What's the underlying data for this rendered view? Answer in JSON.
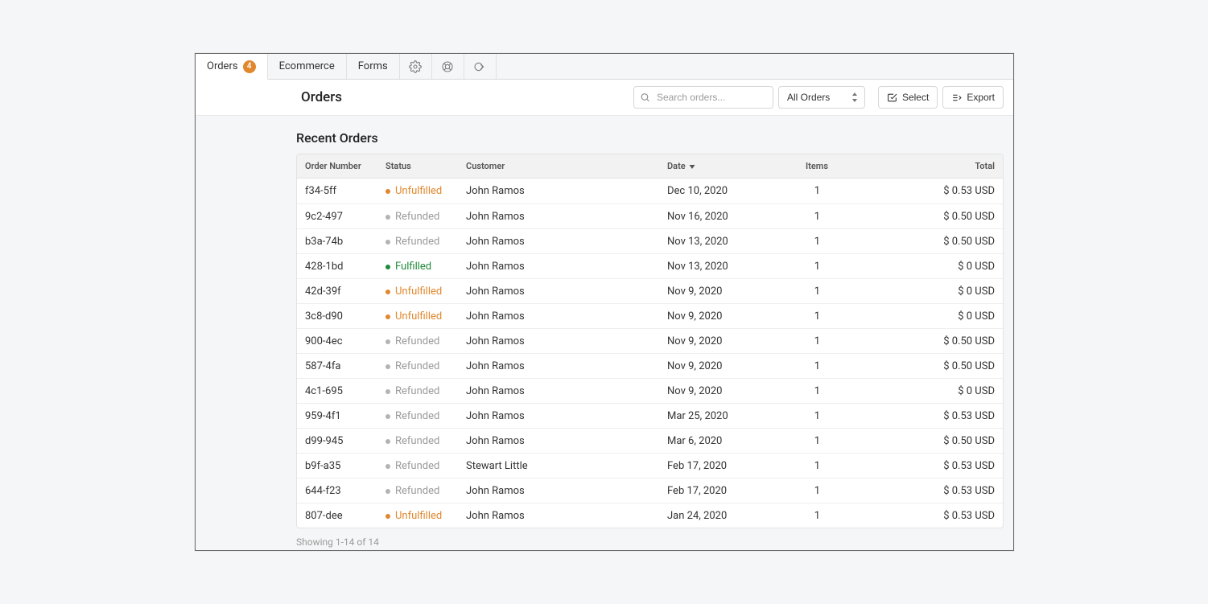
{
  "tabs": {
    "orders": {
      "label": "Orders",
      "badge": "4"
    },
    "ecommerce": {
      "label": "Ecommerce"
    },
    "forms": {
      "label": "Forms"
    }
  },
  "header": {
    "title": "Orders",
    "search_placeholder": "Search orders...",
    "filter_selected": "All Orders",
    "select_btn": "Select",
    "export_btn": "Export"
  },
  "section": {
    "title": "Recent Orders"
  },
  "columns": {
    "order_number": "Order Number",
    "status": "Status",
    "customer": "Customer",
    "date": "Date",
    "items": "Items",
    "total": "Total"
  },
  "statuses": {
    "unfulfilled": "Unfulfilled",
    "refunded": "Refunded",
    "fulfilled": "Fulfilled"
  },
  "rows": [
    {
      "order": "f34-5ff",
      "status": "unfulfilled",
      "customer": "John Ramos",
      "date": "Dec 10, 2020",
      "items": "1",
      "total": "$ 0.53 USD"
    },
    {
      "order": "9c2-497",
      "status": "refunded",
      "customer": "John Ramos",
      "date": "Nov 16, 2020",
      "items": "1",
      "total": "$ 0.50 USD"
    },
    {
      "order": "b3a-74b",
      "status": "refunded",
      "customer": "John Ramos",
      "date": "Nov 13, 2020",
      "items": "1",
      "total": "$ 0.50 USD"
    },
    {
      "order": "428-1bd",
      "status": "fulfilled",
      "customer": "John Ramos",
      "date": "Nov 13, 2020",
      "items": "1",
      "total": "$ 0 USD"
    },
    {
      "order": "42d-39f",
      "status": "unfulfilled",
      "customer": "John Ramos",
      "date": "Nov 9, 2020",
      "items": "1",
      "total": "$ 0 USD"
    },
    {
      "order": "3c8-d90",
      "status": "unfulfilled",
      "customer": "John Ramos",
      "date": "Nov 9, 2020",
      "items": "1",
      "total": "$ 0 USD"
    },
    {
      "order": "900-4ec",
      "status": "refunded",
      "customer": "John Ramos",
      "date": "Nov 9, 2020",
      "items": "1",
      "total": "$ 0.50 USD"
    },
    {
      "order": "587-4fa",
      "status": "refunded",
      "customer": "John Ramos",
      "date": "Nov 9, 2020",
      "items": "1",
      "total": "$ 0.50 USD"
    },
    {
      "order": "4c1-695",
      "status": "refunded",
      "customer": "John Ramos",
      "date": "Nov 9, 2020",
      "items": "1",
      "total": "$ 0 USD"
    },
    {
      "order": "959-4f1",
      "status": "refunded",
      "customer": "John Ramos",
      "date": "Mar 25, 2020",
      "items": "1",
      "total": "$ 0.53 USD"
    },
    {
      "order": "d99-945",
      "status": "refunded",
      "customer": "John Ramos",
      "date": "Mar 6, 2020",
      "items": "1",
      "total": "$ 0.50 USD"
    },
    {
      "order": "b9f-a35",
      "status": "refunded",
      "customer": "Stewart Little",
      "date": "Feb 17, 2020",
      "items": "1",
      "total": "$ 0.53 USD"
    },
    {
      "order": "644-f23",
      "status": "refunded",
      "customer": "John Ramos",
      "date": "Feb 17, 2020",
      "items": "1",
      "total": "$ 0.53 USD"
    },
    {
      "order": "807-dee",
      "status": "unfulfilled",
      "customer": "John Ramos",
      "date": "Jan 24, 2020",
      "items": "1",
      "total": "$ 0.53 USD"
    }
  ],
  "footer": {
    "showing": "Showing 1-14 of 14"
  }
}
